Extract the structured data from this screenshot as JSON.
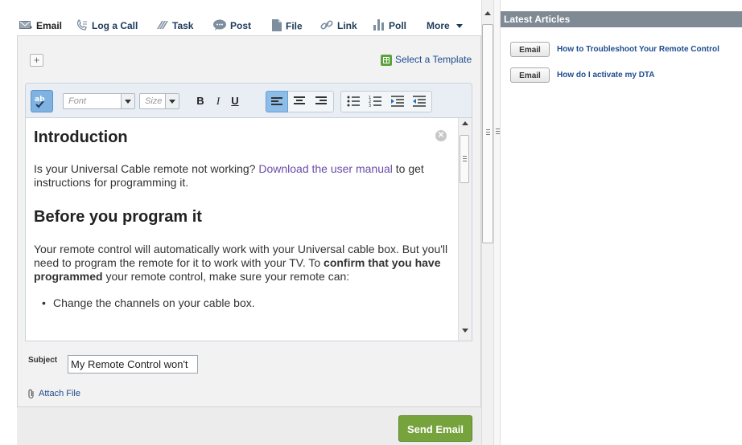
{
  "publisher": {
    "tabs": [
      {
        "label": "Email",
        "icon": "email-icon"
      },
      {
        "label": "Log a Call",
        "icon": "phone-icon"
      },
      {
        "label": "Task",
        "icon": "task-icon"
      },
      {
        "label": "Post",
        "icon": "chat-bubble-icon"
      },
      {
        "label": "File",
        "icon": "file-icon"
      },
      {
        "label": "Link",
        "icon": "link-icon"
      },
      {
        "label": "Poll",
        "icon": "poll-icon"
      },
      {
        "label": "More",
        "icon": "chevron-down-icon"
      }
    ],
    "active_tab": "Email"
  },
  "composer": {
    "select_template": "Select a Template",
    "toolbar": {
      "font_placeholder": "Font",
      "size_placeholder": "Size",
      "bold": "B",
      "italic": "I",
      "underline": "U"
    },
    "body": {
      "heading1": "Introduction",
      "p1_before": "Is your Universal Cable remote not working? ",
      "p1_link": "Download the user manual",
      "p1_after": " to get instructions for programming it.",
      "heading2": "Before you program it",
      "p2_a": "Your remote control will automatically work with your Universal cable box. But you'll need to program the remote for it to work with your TV. To ",
      "p2_bold": "confirm that you have programmed",
      "p2_b": " your remote control, make sure your remote can:",
      "bullet1": "Change the channels on your cable box."
    },
    "subject_label": "Subject",
    "subject_value": "My Remote Control won't",
    "attach_label": "Attach File",
    "send_label": "Send Email"
  },
  "sidebar": {
    "title": "Latest Articles",
    "articles": [
      {
        "button": "Email",
        "title": "How to Troubleshoot Your Remote Control"
      },
      {
        "button": "Email",
        "title": "How do I activate my DTA"
      }
    ]
  },
  "colors": {
    "send_button": "#76a33c",
    "link": "#1f4c8f",
    "body_link": "#6a4ca8",
    "sidebar_header": "#7f8a95"
  }
}
